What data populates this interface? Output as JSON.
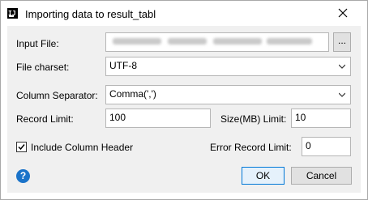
{
  "window": {
    "title": "Importing data to result_tabl"
  },
  "form": {
    "input_file_label": "Input File:",
    "browse_label": "...",
    "charset_label": "File charset:",
    "charset_value": "UTF-8",
    "separator_label": "Column Separator:",
    "separator_value": "Comma(',')",
    "record_limit_label": "Record Limit:",
    "record_limit_value": "100",
    "size_limit_label": "Size(MB) Limit:",
    "size_limit_value": "10",
    "include_header_label": "Include Column Header",
    "include_header_checked": true,
    "error_limit_label": "Error Record Limit:",
    "error_limit_value": "0"
  },
  "buttons": {
    "ok": "OK",
    "cancel": "Cancel"
  },
  "icons": {
    "app": "app-icon",
    "close": "close-icon",
    "help": "help-icon",
    "check": "checkmark-icon",
    "dropdown": "chevron-down-icon"
  },
  "colors": {
    "accent": "#0078d7",
    "help": "#1a73c9",
    "panel": "#f0f0f0"
  }
}
